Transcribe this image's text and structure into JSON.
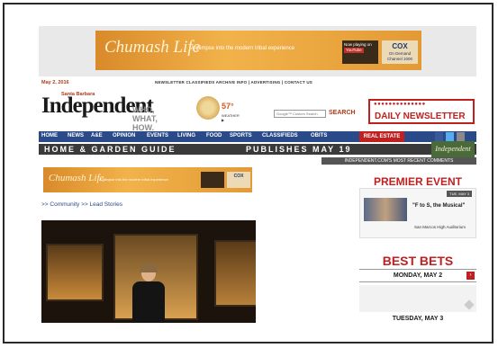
{
  "top_banner": {
    "logo": "Chumash Life",
    "tagline": "A glimpse into the modern tribal experience",
    "playing_label": "Now playing on",
    "youtube": "YouTube",
    "cox_brand": "COX",
    "cox_sub": "On Demand Channel 1000"
  },
  "date": "May 2, 2016",
  "top_links": "NEWSLETTER  CLASSIFIEDS  ARCHIVE  INFO | ADVERTISING | CONTACT US",
  "masthead": {
    "overline": "Santa Barbara",
    "name": "Independent",
    "slogan": "WHO, WHAT, HOW.",
    "temperature": "57°",
    "weather": "WEATHER ▶"
  },
  "search": {
    "placeholder": "Google™ Custom Search",
    "label": "SEARCH"
  },
  "daily_newsletter": "DAILY NEWSLETTER",
  "nav": {
    "items": [
      "HOME",
      "NEWS",
      "A&E",
      "OPINION",
      "EVENTS",
      "LIVING",
      "FOOD",
      "SPORTS",
      "CLASSIFIEDS",
      "OBITS"
    ],
    "real_estate": "REAL ESTATE"
  },
  "home_garden": {
    "left": "HOME & GARDEN GUIDE",
    "right": "PUBLISHES MAY 19"
  },
  "indep_badge": "Independent",
  "recent_comments": "INDEPENDENT.COM'S MOST RECENT COMMENTS",
  "second_banner": {
    "logo": "Chumash Life",
    "tagline": "A glimpse into the modern tribal experience",
    "cox_brand": "COX"
  },
  "breadcrumb": ">> Community >> Lead Stories",
  "premier_event": {
    "title": "PREMIER EVENT",
    "date_tag": "TUE, MAY 3",
    "event": "\"F to S, the Musical\"",
    "venue": "San Marcos High Auditorium"
  },
  "best_bets": {
    "title": "BEST BETS",
    "day1": "MONDAY, MAY 2",
    "day2": "TUESDAY, MAY 3"
  },
  "colors": {
    "nav_blue": "#2a4a8a",
    "accent_red": "#c02020",
    "banner_orange": "#e39a35"
  }
}
